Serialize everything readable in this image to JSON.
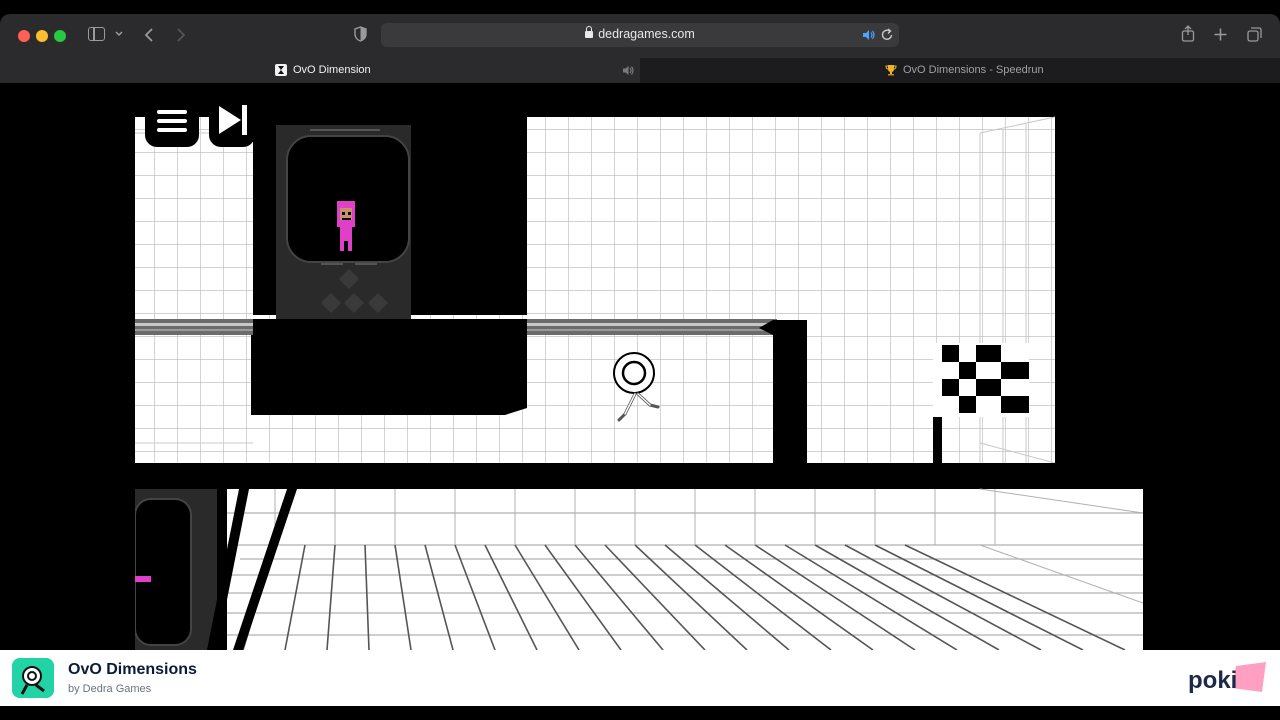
{
  "browser": {
    "url": "dedragames.com",
    "tabs": [
      {
        "label": "OvO Dimension",
        "active": true
      },
      {
        "label": "OvO Dimensions - Speedrun",
        "active": false
      }
    ]
  },
  "game": {
    "buttons": [
      {
        "name": "menu",
        "icon": "hamburger-icon"
      },
      {
        "name": "skip",
        "icon": "skip-forward-icon"
      }
    ],
    "colors": {
      "wall": "#000000",
      "grid_bg": "#ffffff",
      "grid_line": "#b0b0b0",
      "player_accent": "#e040c8"
    }
  },
  "info": {
    "title": "OvO Dimensions",
    "author": "by Dedra Games",
    "brand": "poki"
  }
}
